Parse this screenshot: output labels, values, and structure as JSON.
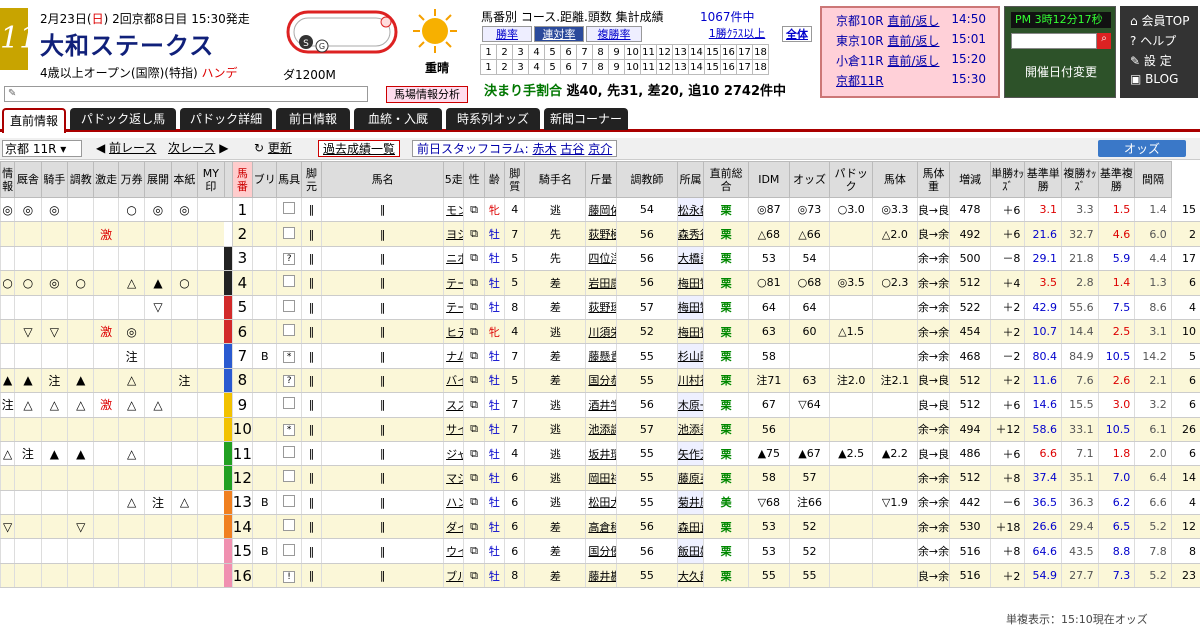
{
  "race": {
    "number": "11",
    "date_prefix": "2月23日(",
    "date_day": "日",
    "date_suffix": ") 2回京都8日目 15:30発走",
    "name": "大和ステークス",
    "conditions": "4歳以上オープン(国際)(特指)",
    "handicap": "ハンデ",
    "distance": "ダ1200M",
    "weather": "重晴",
    "paddock_button": "馬場情報分析"
  },
  "stats": {
    "title": "馬番別 コース.距離.頭数 集計成績",
    "count": "1067件中",
    "tabs": [
      "勝率",
      "連対率",
      "複勝率",
      "1勝ｸﾗｽ以上",
      "全体"
    ],
    "pace_prefix": "決まり手割合",
    "pace_values": "逃40, 先31, 差20, 追10",
    "pace_count": "2742件中"
  },
  "upcoming": [
    {
      "race": "京都10R",
      "links": "直前/返し",
      "time": "14:50"
    },
    {
      "race": "東京10R",
      "links": "直前/返し",
      "time": "15:01"
    },
    {
      "race": "小倉11R",
      "links": "直前/返し",
      "time": "15:20"
    },
    {
      "race": "京都11R",
      "links": "",
      "time": "15:30"
    }
  ],
  "clock": {
    "time": "PM 3時12分17秒",
    "date_change": "開催日付変更"
  },
  "side_links": [
    "会員TOP",
    "ヘルプ",
    "設 定",
    "BLOG"
  ],
  "tabs": [
    "直前情報",
    "パドック返し馬",
    "パドック詳細",
    "前日情報",
    "血統・入厩",
    "時系列オッズ",
    "新聞コーナー"
  ],
  "controls": {
    "race_select": "京都 11R",
    "prev_race": "前レース",
    "next_race": "次レース",
    "refresh": "更新",
    "past_results": "過去成績一覧",
    "column_prefix": "前日スタッフコラム:",
    "column_names": [
      "赤木",
      "古谷",
      "京介"
    ],
    "odds": "オッズ"
  },
  "columns": [
    "情報",
    "厩舎",
    "騎手",
    "調教",
    "激走",
    "万券",
    "展開",
    "本紙",
    "MY印",
    "馬番",
    "ブリ",
    "馬具",
    "脚元",
    "馬名",
    "5走",
    "性",
    "齢",
    "脚質",
    "騎手名",
    "斤量",
    "調教師",
    "所属",
    "直前総合",
    "IDM",
    "オッズ",
    "パドック",
    "馬体",
    "馬体重",
    "増減",
    "単勝ｵｯｽﾞ",
    "基準単勝",
    "複勝ｵｯｽﾞ",
    "基準複勝",
    "間隔"
  ],
  "colors": {
    "accent_red": "#aa0000",
    "navy": "#10207a",
    "row_alt": "#fbf7d8"
  },
  "horses": [
    {
      "marks": [
        "◎",
        "◎",
        "◎",
        "",
        "",
        "○",
        "◎",
        "◎",
        ""
      ],
      "num": "1",
      "gate": "#ffffff",
      "bri": "",
      "gu": "",
      "ashi": "",
      "name": "モンペルデュ",
      "sex": "牝",
      "age": "4",
      "style": "逃",
      "jockey": "藤岡佑[替]",
      "kin": "54",
      "trainer": "松永幹",
      "shozoku": "栗",
      "sogo": "◎87",
      "idm": "◎73",
      "odds_m": "○3.0",
      "pad": "◎3.3",
      "tai": "良→良",
      "weight": "478",
      "diff": "＋6",
      "tan": "3.1",
      "kt": "3.3",
      "fuku": "1.5",
      "kf": "1.4",
      "kan": "15"
    },
    {
      "marks": [
        "",
        "",
        "",
        "",
        "激",
        "",
        "",
        "",
        ""
      ],
      "num": "2",
      "gate": "#ffffff",
      "bri": "",
      "gu": "",
      "ashi": "",
      "name": "ヨシオ",
      "sex": "牡",
      "age": "7",
      "style": "先",
      "jockey": "荻野極[替]",
      "kin": "56",
      "trainer": "森秀行",
      "shozoku": "栗",
      "sogo": "△68",
      "idm": "△66",
      "odds_m": "",
      "pad": "△2.0",
      "tai": "良→余",
      "weight": "492",
      "diff": "＋6",
      "tan": "21.6",
      "kt": "32.7",
      "fuku": "4.6",
      "kf": "6.0",
      "kan": "2"
    },
    {
      "marks": [
        "",
        "",
        "",
        "",
        "",
        "",
        "",
        "",
        ""
      ],
      "num": "3",
      "gate": "#222222",
      "bri": "",
      "gu": "?",
      "ashi": "",
      "name": "ニホンピロタイド",
      "sex": "牡",
      "age": "5",
      "style": "先",
      "jockey": "四位洋[替]",
      "kin": "56",
      "trainer": "大橋勇",
      "shozoku": "栗",
      "sogo": "53",
      "idm": "54",
      "odds_m": "",
      "pad": "",
      "tai": "余→余",
      "weight": "500",
      "diff": "－8",
      "tan": "29.1",
      "kt": "21.8",
      "fuku": "5.9",
      "kf": "4.4",
      "kan": "17"
    },
    {
      "marks": [
        "○",
        "○",
        "◎",
        "○",
        "",
        "△",
        "▲",
        "○",
        ""
      ],
      "num": "4",
      "gate": "#222222",
      "bri": "",
      "gu": "",
      "ashi": "",
      "name": "テーオージーニアス",
      "sex": "牡",
      "age": "5",
      "style": "差",
      "jockey": "岩田康[替]",
      "kin": "56",
      "trainer": "梅田智",
      "shozoku": "栗",
      "sogo": "○81",
      "idm": "○68",
      "odds_m": "◎3.5",
      "pad": "○2.3",
      "tai": "余→余",
      "weight": "512",
      "diff": "＋4",
      "tan": "3.5",
      "kt": "2.8",
      "fuku": "1.4",
      "kf": "1.3",
      "kan": "6"
    },
    {
      "marks": [
        "",
        "",
        "",
        "",
        "",
        "",
        "▽",
        "",
        ""
      ],
      "num": "5",
      "gate": "#d22a2a",
      "bri": "",
      "gu": "",
      "ashi": "",
      "name": "テーオーヘリオス",
      "sex": "牡",
      "age": "8",
      "style": "差",
      "jockey": "荻野琢[替]",
      "kin": "57",
      "trainer": "梅田智",
      "shozoku": "栗",
      "sogo": "64",
      "idm": "64",
      "odds_m": "",
      "pad": "",
      "tai": "余→余",
      "weight": "522",
      "diff": "＋2",
      "tan": "42.9",
      "kt": "55.6",
      "fuku": "7.5",
      "kf": "8.6",
      "kan": "4"
    },
    {
      "marks": [
        "",
        "▽",
        "▽",
        "",
        "激",
        "◎",
        "",
        "",
        ""
      ],
      "num": "6",
      "gate": "#d22a2a",
      "bri": "",
      "gu": "",
      "ashi": "",
      "name": "ヒデノヴィーナス",
      "sex": "牝",
      "age": "4",
      "style": "逃",
      "jockey": "川須栄[替]",
      "kin": "52",
      "trainer": "梅田智",
      "shozoku": "栗",
      "sogo": "63",
      "idm": "60",
      "odds_m": "△1.5",
      "pad": "",
      "tai": "余→余",
      "weight": "454",
      "diff": "＋2",
      "tan": "10.7",
      "kt": "14.4",
      "fuku": "2.5",
      "kf": "3.1",
      "kan": "10"
    },
    {
      "marks": [
        "",
        "",
        "",
        "",
        "",
        "注",
        "",
        "",
        ""
      ],
      "num": "7",
      "gate": "#2a5ad0",
      "bri": "B",
      "gu": "*",
      "ashi": "",
      "name": "ナムラミラクル",
      "sex": "牡",
      "age": "7",
      "style": "差",
      "jockey": "藤懸貴",
      "kin": "55",
      "trainer": "杉山晴",
      "shozoku": "栗",
      "sogo": "58",
      "idm": "",
      "odds_m": "",
      "pad": "",
      "tai": "余→余",
      "weight": "468",
      "diff": "－2",
      "tan": "80.4",
      "kt": "84.9",
      "fuku": "10.5",
      "kf": "14.2",
      "kan": "5"
    },
    {
      "marks": [
        "▲",
        "▲",
        "注",
        "▲",
        "",
        "△",
        "",
        "注",
        ""
      ],
      "num": "8",
      "gate": "#2a5ad0",
      "bri": "",
      "gu": "?",
      "ashi": "",
      "name": "バイラ",
      "sex": "牡",
      "age": "5",
      "style": "差",
      "jockey": "国分恭[替]",
      "kin": "55",
      "trainer": "川村禎",
      "shozoku": "栗",
      "sogo": "注71",
      "idm": "63",
      "odds_m": "注2.0",
      "pad": "注2.1",
      "tai": "良→良",
      "weight": "512",
      "diff": "＋2",
      "tan": "11.6",
      "kt": "7.6",
      "fuku": "2.6",
      "kf": "2.1",
      "kan": "6"
    },
    {
      "marks": [
        "注",
        "△",
        "△",
        "△",
        "激",
        "△",
        "△",
        "",
        ""
      ],
      "num": "9",
      "gate": "#f2c200",
      "bri": "",
      "gu": "",
      "ashi": "",
      "name": "スズカコーズライン",
      "sex": "牡",
      "age": "7",
      "style": "逃",
      "jockey": "酒井学",
      "kin": "56",
      "trainer": "木原一",
      "shozoku": "栗",
      "sogo": "67",
      "idm": "▽64",
      "odds_m": "",
      "pad": "",
      "tai": "良→良",
      "weight": "512",
      "diff": "＋6",
      "tan": "14.6",
      "kt": "15.5",
      "fuku": "3.0",
      "kf": "3.2",
      "kan": "6"
    },
    {
      "marks": [
        "",
        "",
        "",
        "",
        "",
        "",
        "",
        "",
        ""
      ],
      "num": "10",
      "gate": "#f2c200",
      "bri": "",
      "gu": "*",
      "ashi": "",
      "name": "サイタスリーレッド",
      "sex": "牡",
      "age": "7",
      "style": "逃",
      "jockey": "池添謙[替]",
      "kin": "57",
      "trainer": "池添兼",
      "shozoku": "栗",
      "sogo": "56",
      "idm": "",
      "odds_m": "",
      "pad": "",
      "tai": "余→余",
      "weight": "494",
      "diff": "＋12",
      "tan": "58.6",
      "kt": "33.1",
      "fuku": "10.5",
      "kf": "6.1",
      "kan": "26"
    },
    {
      "marks": [
        "△",
        "注",
        "▲",
        "▲",
        "",
        "△",
        "",
        "",
        ""
      ],
      "num": "11",
      "gate": "#22a022",
      "bri": "",
      "gu": "",
      "ashi": "",
      "name": "ジャスティン",
      "sex": "牡",
      "age": "4",
      "style": "逃",
      "jockey": "坂井瑠",
      "kin": "55",
      "trainer": "矢作芳",
      "shozoku": "栗",
      "sogo": "▲75",
      "idm": "▲67",
      "odds_m": "▲2.5",
      "pad": "▲2.2",
      "tai": "良→良",
      "weight": "486",
      "diff": "＋6",
      "tan": "6.6",
      "kt": "7.1",
      "fuku": "1.8",
      "kf": "2.0",
      "kan": "6"
    },
    {
      "marks": [
        "",
        "",
        "",
        "",
        "",
        "",
        "",
        "",
        ""
      ],
      "num": "12",
      "gate": "#22a022",
      "bri": "",
      "gu": "",
      "ashi": "",
      "name": "マジカルスペル",
      "sex": "牡",
      "age": "6",
      "style": "逃",
      "jockey": "岡田祥[替]",
      "kin": "55",
      "trainer": "藤原英",
      "shozoku": "栗",
      "sogo": "58",
      "idm": "57",
      "odds_m": "",
      "pad": "",
      "tai": "余→余",
      "weight": "512",
      "diff": "＋8",
      "tan": "37.4",
      "kt": "35.1",
      "fuku": "7.0",
      "kf": "6.4",
      "kan": "14"
    },
    {
      "marks": [
        "",
        "",
        "",
        "",
        "",
        "△",
        "注",
        "△",
        ""
      ],
      "num": "13",
      "gate": "#f08020",
      "bri": "B",
      "gu": "",
      "ashi": "",
      "name": "ハングリーベン",
      "sex": "牡",
      "age": "6",
      "style": "逃",
      "jockey": "松田大[替]",
      "kin": "55",
      "trainer": "菊井康",
      "shozoku": "美",
      "sogo": "▽68",
      "idm": "注66",
      "odds_m": "",
      "pad": "▽1.9",
      "tai": "余→余",
      "weight": "442",
      "diff": "－6",
      "tan": "36.5",
      "kt": "36.3",
      "fuku": "6.2",
      "kf": "6.6",
      "kan": "4"
    },
    {
      "marks": [
        "▽",
        "",
        "",
        "▽",
        "",
        "",
        "",
        "",
        ""
      ],
      "num": "14",
      "gate": "#f08020",
      "bri": "",
      "gu": "",
      "ashi": "",
      "name": "ダイメイフジ",
      "sex": "牡",
      "age": "6",
      "style": "差",
      "jockey": "高倉稜[替]",
      "kin": "56",
      "trainer": "森田直",
      "shozoku": "栗",
      "sogo": "53",
      "idm": "52",
      "odds_m": "",
      "pad": "",
      "tai": "余→余",
      "weight": "530",
      "diff": "＋18",
      "tan": "26.6",
      "kt": "29.4",
      "fuku": "6.5",
      "kf": "5.2",
      "kan": "12"
    },
    {
      "marks": [
        "",
        "",
        "",
        "",
        "",
        "",
        "",
        "",
        ""
      ],
      "num": "15",
      "gate": "#f090b0",
      "bri": "B",
      "gu": "",
      "ashi": "",
      "name": "ウインオスカー",
      "sex": "牡",
      "age": "6",
      "style": "差",
      "jockey": "国分優[替]",
      "kin": "56",
      "trainer": "飯田雄",
      "shozoku": "栗",
      "sogo": "53",
      "idm": "52",
      "odds_m": "",
      "pad": "",
      "tai": "余→余",
      "weight": "516",
      "diff": "＋8",
      "tan": "64.6",
      "kt": "43.5",
      "fuku": "8.8",
      "kf": "7.8",
      "kan": "8"
    },
    {
      "marks": [
        "",
        "",
        "",
        "",
        "",
        "",
        "",
        "",
        ""
      ],
      "num": "16",
      "gate": "#f090b0",
      "bri": "",
      "gu": "!",
      "ashi": "",
      "name": "ブルミラコロ",
      "sex": "牡",
      "age": "8",
      "style": "差",
      "jockey": "藤井勘[替]",
      "kin": "55",
      "trainer": "大久龍",
      "shozoku": "栗",
      "sogo": "55",
      "idm": "55",
      "odds_m": "",
      "pad": "",
      "tai": "良→余",
      "weight": "516",
      "diff": "＋2",
      "tan": "54.9",
      "kt": "27.7",
      "fuku": "7.3",
      "kf": "5.2",
      "kan": "23"
    }
  ],
  "footer": "単複表示：15:10現在オッズ"
}
